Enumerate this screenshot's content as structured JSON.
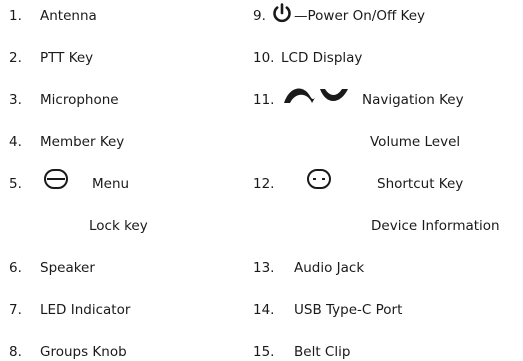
{
  "left": {
    "items": [
      {
        "num": "1.",
        "label": "Antenna"
      },
      {
        "num": "2.",
        "label": "PTT Key"
      },
      {
        "num": "3.",
        "label": "Microphone"
      },
      {
        "num": "4.",
        "label": "Member Key"
      },
      {
        "num": "5.",
        "label": "Menu",
        "sub": "Lock key",
        "icon": "minus-circle-icon"
      },
      {
        "num": "6.",
        "label": "Speaker"
      },
      {
        "num": "7.",
        "label": "LED Indicator"
      },
      {
        "num": "8.",
        "label": "Groups Knob"
      }
    ]
  },
  "right": {
    "items": [
      {
        "num": "9.",
        "label": "—Power On/Off Key",
        "icon": "power-icon"
      },
      {
        "num": "10.",
        "label": "LCD Display"
      },
      {
        "num": "11.",
        "label": "Navigation Key",
        "sub": "Volume Level",
        "icon": "navigation-arrows-icon"
      },
      {
        "num": "12.",
        "label": "Shortcut Key",
        "sub": "Device Information",
        "icon": "dots-circle-icon"
      },
      {
        "num": "13.",
        "label": "Audio Jack"
      },
      {
        "num": "14.",
        "label": "USB Type-C Port"
      },
      {
        "num": "15.",
        "label": "Belt Clip"
      }
    ]
  }
}
